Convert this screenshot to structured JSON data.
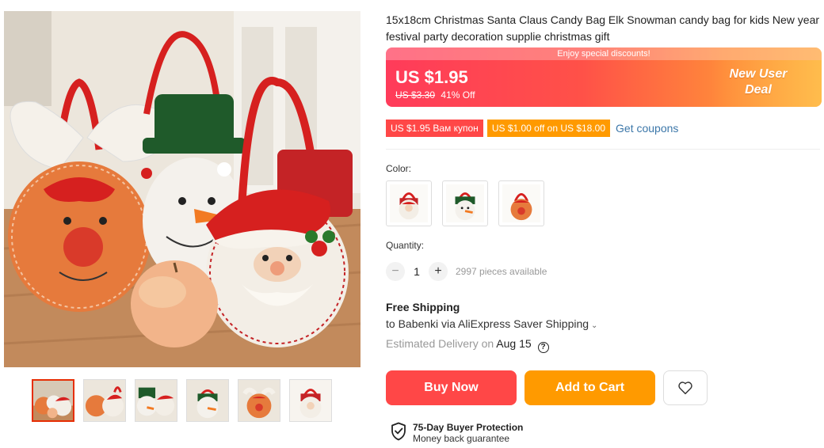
{
  "product": {
    "title": "15x18cm Christmas Santa Claus Candy Bag Elk Snowman candy bag for kids New year festival party decoration supplie christmas gift"
  },
  "price": {
    "promo_strip": "Enjoy special discounts!",
    "current": "US $1.95",
    "original": "US $3.30",
    "discount": "41% Off",
    "new_user_deal": "New User Deal",
    "banner_colors": [
      "#ff3b5a",
      "#ff8a3a"
    ]
  },
  "coupons": {
    "items": [
      {
        "label": "US $1.95 Вам купон",
        "color": "#ff4747"
      },
      {
        "label": "US $1.00 off on US $18.00",
        "color": "#ff9a00"
      }
    ],
    "link": "Get coupons"
  },
  "color_select": {
    "label": "Color:",
    "options": [
      "santa-bag",
      "snowman-bag",
      "reindeer-bag"
    ]
  },
  "quantity": {
    "label": "Quantity:",
    "value": "1",
    "minus_icon": "minus-icon",
    "plus_icon": "plus-icon",
    "available": "2997 pieces available"
  },
  "shipping": {
    "title": "Free Shipping",
    "to": "to Babenki via AliExpress Saver Shipping",
    "eta_label": "Estimated Delivery on",
    "eta_date": "Aug 15"
  },
  "actions": {
    "buy_now": "Buy Now",
    "add_to_cart": "Add to Cart",
    "wishlist_icon": "heart-icon"
  },
  "protection": {
    "title": "75-Day Buyer Protection",
    "subtitle": "Money back guarantee"
  },
  "gallery": {
    "thumbnail_count": 6,
    "active_index": 0
  }
}
